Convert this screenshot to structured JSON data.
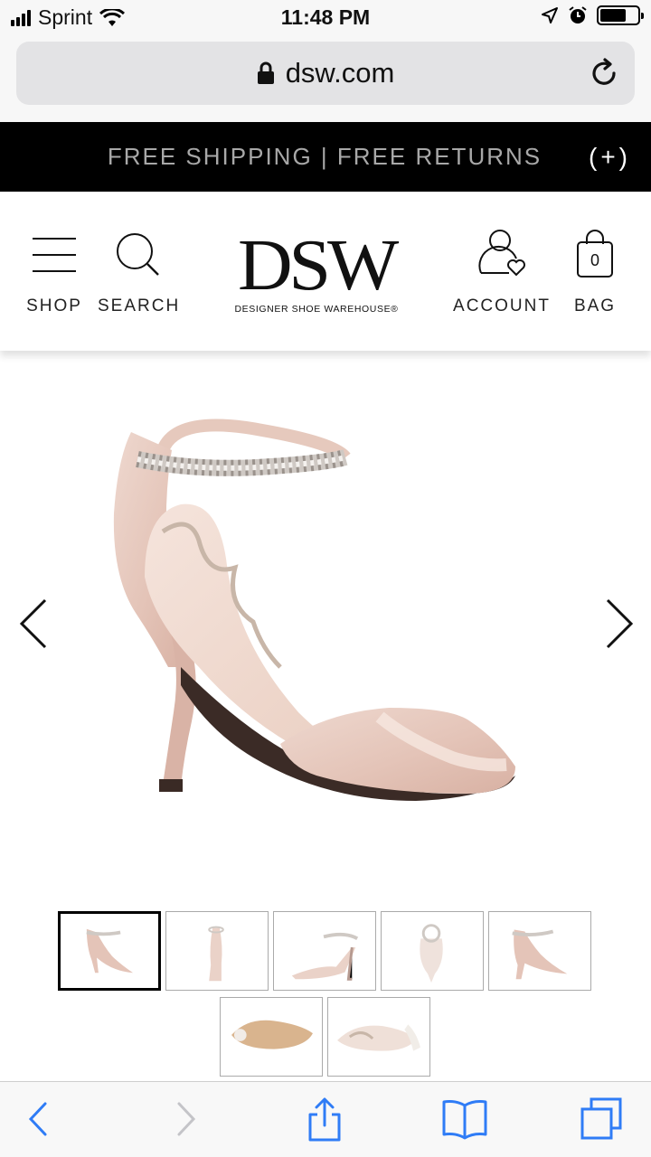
{
  "status_bar": {
    "carrier": "Sprint",
    "time": "11:48 PM"
  },
  "browser": {
    "url": "dsw.com",
    "lock_icon": "lock-icon",
    "reload_icon": "reload-icon"
  },
  "promo": {
    "text": "FREE SHIPPING | FREE RETURNS",
    "toggle": "(+)"
  },
  "header": {
    "shop_label": "SHOP",
    "search_label": "SEARCH",
    "account_label": "ACCOUNT",
    "bag_label": "BAG",
    "bag_count": "0",
    "logo_main": "DSW",
    "logo_sub": "DESIGNER SHOE WAREHOUSE®"
  },
  "product": {
    "image": "blush-satin-ankle-strap-sandal",
    "prev_icon": "chevron-left-icon",
    "next_icon": "chevron-right-icon",
    "thumbnail_count": 7,
    "selected_thumbnail": 1,
    "accent_color": "#e9cfc4"
  },
  "bottom_toolbar": {
    "icons": [
      "back-icon",
      "forward-icon",
      "share-icon",
      "bookmarks-icon",
      "tabs-icon"
    ],
    "accent_color": "#2f7cf6"
  }
}
